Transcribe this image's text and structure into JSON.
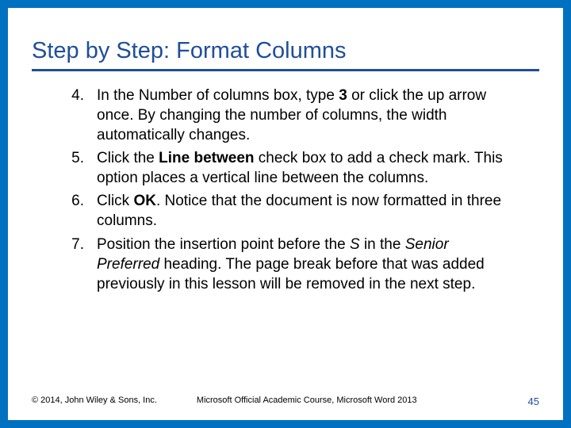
{
  "title": "Step by Step: Format Columns",
  "steps": [
    {
      "num": "4.",
      "html": "In the Number of columns box, type <b>3</b> or click the up arrow once. By changing the number of columns, the width automatically changes."
    },
    {
      "num": "5.",
      "html": "Click the <b>Line between</b> check box to add a check mark. This option places a vertical line between the columns."
    },
    {
      "num": "6.",
      "html": "Click <b>OK</b>. Notice that the document is now formatted in three columns."
    },
    {
      "num": "7.",
      "html": "Position the insertion point before the <i>S</i> in the <i>Senior Preferred</i> heading. The page break before that was added previously in this lesson will be removed in the next step."
    }
  ],
  "footer": {
    "copyright": "© 2014, John Wiley & Sons, Inc.",
    "center": "Microsoft Official Academic Course, Microsoft Word 2013",
    "page": "45"
  }
}
